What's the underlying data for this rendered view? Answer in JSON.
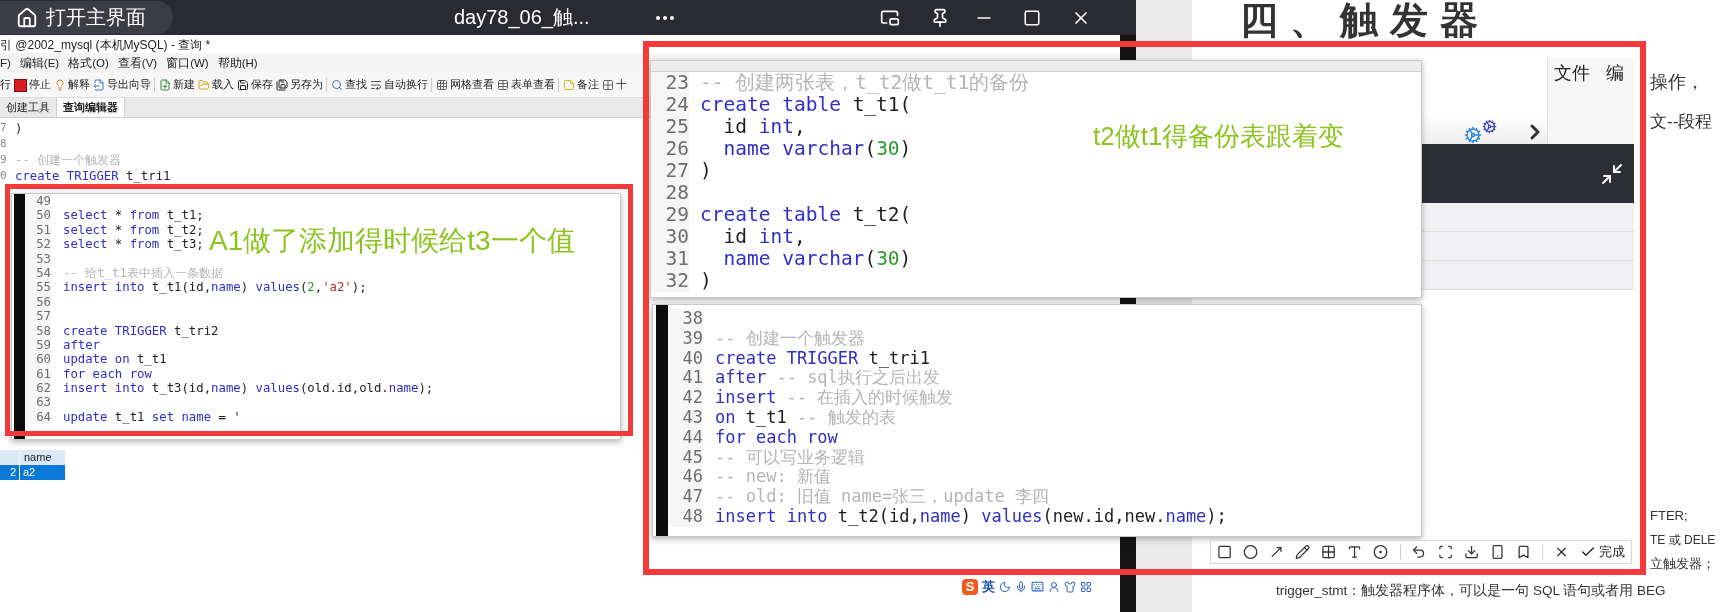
{
  "top_bar": {
    "home_button": "打开主界面",
    "title": "day78_06_触..."
  },
  "editor_window": {
    "title": "引 @2002_mysql (本机MySQL) - 查询 *",
    "menu": [
      "F)",
      "编辑(E)",
      "格式(O)",
      "查看(V)",
      "窗口(W)",
      "帮助(H)"
    ],
    "toolbar": [
      [
        {
          "label": "行",
          "kind": "run"
        },
        {
          "label": "停止",
          "kind": "stop"
        },
        {
          "label": "解释",
          "kind": "explain"
        },
        {
          "label": "导出向导",
          "kind": "export"
        }
      ],
      [
        {
          "label": "新建",
          "kind": "new"
        },
        {
          "label": "载入",
          "kind": "load"
        },
        {
          "label": "保存",
          "kind": "save"
        },
        {
          "label": "另存为",
          "kind": "save_as"
        }
      ],
      [
        {
          "label": "查找",
          "kind": "find"
        },
        {
          "label": "自动换行",
          "kind": "wrap"
        }
      ],
      [
        {
          "label": "网格查看",
          "kind": "grid"
        },
        {
          "label": "表单查看",
          "kind": "form"
        }
      ],
      [
        {
          "label": "备注",
          "kind": "note"
        },
        {
          "label": "十",
          "kind": "hex"
        }
      ]
    ],
    "tabs": [
      {
        "label": "创建工具",
        "selected": false
      },
      {
        "label": "查询编辑器",
        "selected": true
      }
    ],
    "code": [
      {
        "n": "7",
        "tokens": [
          {
            "kind": "plain",
            "text": ")"
          }
        ]
      },
      {
        "n": "8"
      },
      {
        "n": "9",
        "tokens": [
          {
            "kind": "comment",
            "text": "-- 创建一个触发器"
          }
        ]
      },
      {
        "n": "0",
        "tokens": [
          {
            "kind": "keyword",
            "text": "create TRIGGER"
          },
          {
            "kind": "plain",
            "text": " t_tri1"
          }
        ]
      }
    ],
    "result": {
      "columns": [
        "name"
      ],
      "rows": [
        {
          "num": "2",
          "cells": [
            "a2"
          ],
          "selected": true
        }
      ]
    }
  },
  "popups": [
    {
      "kind": "small",
      "annotation": "A1做了添加得时候给t3一个值",
      "lines": [
        {
          "n": "49"
        },
        {
          "n": "50",
          "tokens": [
            {
              "kind": "keyword",
              "text": "select"
            },
            {
              "kind": "plain",
              "text": " * "
            },
            {
              "kind": "keyword",
              "text": "from"
            },
            {
              "kind": "plain",
              "text": " t_t1;"
            }
          ]
        },
        {
          "n": "51",
          "tokens": [
            {
              "kind": "keyword",
              "text": "select"
            },
            {
              "kind": "plain",
              "text": " * "
            },
            {
              "kind": "keyword",
              "text": "from"
            },
            {
              "kind": "plain",
              "text": " t_t2;"
            }
          ]
        },
        {
          "n": "52",
          "tokens": [
            {
              "kind": "keyword",
              "text": "select"
            },
            {
              "kind": "plain",
              "text": " * "
            },
            {
              "kind": "keyword",
              "text": "from"
            },
            {
              "kind": "plain",
              "text": " t_t3;"
            }
          ]
        },
        {
          "n": "53"
        },
        {
          "n": "54",
          "tokens": [
            {
              "kind": "comment",
              "text": "-- 给t_t1表中插入一条数据"
            }
          ]
        },
        {
          "n": "55",
          "tokens": [
            {
              "kind": "keyword",
              "text": "insert into"
            },
            {
              "kind": "plain",
              "text": " t_t1(id,"
            },
            {
              "kind": "keyword",
              "text": "name"
            },
            {
              "kind": "plain",
              "text": ") "
            },
            {
              "kind": "keyword",
              "text": "values"
            },
            {
              "kind": "plain",
              "text": "("
            },
            {
              "kind": "number",
              "text": "2"
            },
            {
              "kind": "plain",
              "text": ","
            },
            {
              "kind": "string",
              "text": "'a2'"
            },
            {
              "kind": "plain",
              "text": ");"
            }
          ]
        },
        {
          "n": "56"
        },
        {
          "n": "57"
        },
        {
          "n": "58",
          "tokens": [
            {
              "kind": "keyword",
              "text": "create TRIGGER"
            },
            {
              "kind": "plain",
              "text": " t_tri2"
            }
          ]
        },
        {
          "n": "59",
          "tokens": [
            {
              "kind": "keyword",
              "text": "after"
            }
          ]
        },
        {
          "n": "60",
          "tokens": [
            {
              "kind": "keyword",
              "text": "update on"
            },
            {
              "kind": "plain",
              "text": " t_t1"
            }
          ]
        },
        {
          "n": "61",
          "tokens": [
            {
              "kind": "keyword",
              "text": "for each row"
            }
          ]
        },
        {
          "n": "62",
          "tokens": [
            {
              "kind": "keyword",
              "text": "insert into"
            },
            {
              "kind": "plain",
              "text": " t_t3(id,"
            },
            {
              "kind": "keyword",
              "text": "name"
            },
            {
              "kind": "plain",
              "text": ") "
            },
            {
              "kind": "keyword",
              "text": "values"
            },
            {
              "kind": "plain",
              "text": "(old.id,old."
            },
            {
              "kind": "keyword",
              "text": "name"
            },
            {
              "kind": "plain",
              "text": ");"
            }
          ]
        },
        {
          "n": "63"
        },
        {
          "n": "64",
          "tokens": [
            {
              "kind": "keyword",
              "text": "update"
            },
            {
              "kind": "plain",
              "text": " t_t1 "
            },
            {
              "kind": "keyword",
              "text": "set name"
            },
            {
              "kind": "plain",
              "text": " = '"
            }
          ]
        }
      ]
    },
    {
      "kind": "large",
      "annotation": "t2做t1得备份表跟着变",
      "lines": [
        {
          "n": "23",
          "tokens": [
            {
              "kind": "comment",
              "text": "-- 创建两张表，t_t2做t_t1的备份"
            }
          ]
        },
        {
          "n": "24",
          "tokens": [
            {
              "kind": "keyword",
              "text": "create table"
            },
            {
              "kind": "plain",
              "text": " t_t1("
            }
          ]
        },
        {
          "n": "25",
          "tokens": [
            {
              "kind": "plain",
              "text": "  id "
            },
            {
              "kind": "keyword",
              "text": "int"
            },
            {
              "kind": "plain",
              "text": ","
            }
          ]
        },
        {
          "n": "26",
          "tokens": [
            {
              "kind": "keyword",
              "text": "  name varchar"
            },
            {
              "kind": "plain",
              "text": "("
            },
            {
              "kind": "number",
              "text": "30"
            },
            {
              "kind": "plain",
              "text": ")"
            }
          ]
        },
        {
          "n": "27",
          "tokens": [
            {
              "kind": "plain",
              "text": ")"
            }
          ]
        },
        {
          "n": "28"
        },
        {
          "n": "29",
          "tokens": [
            {
              "kind": "keyword",
              "text": "create table"
            },
            {
              "kind": "plain",
              "text": " t_t2("
            }
          ]
        },
        {
          "n": "30",
          "tokens": [
            {
              "kind": "plain",
              "text": "  id "
            },
            {
              "kind": "keyword",
              "text": "int"
            },
            {
              "kind": "plain",
              "text": ","
            }
          ]
        },
        {
          "n": "31",
          "tokens": [
            {
              "kind": "keyword",
              "text": "  name varchar"
            },
            {
              "kind": "plain",
              "text": "("
            },
            {
              "kind": "number",
              "text": "30"
            },
            {
              "kind": "plain",
              "text": ")"
            }
          ]
        },
        {
          "n": "32",
          "tokens": [
            {
              "kind": "plain",
              "text": ")"
            }
          ]
        }
      ]
    },
    {
      "kind": "medium",
      "lines": [
        {
          "n": "38"
        },
        {
          "n": "39",
          "tokens": [
            {
              "kind": "comment",
              "text": "-- 创建一个触发器"
            }
          ]
        },
        {
          "n": "40",
          "tokens": [
            {
              "kind": "keyword",
              "text": "create TRIGGER"
            },
            {
              "kind": "plain",
              "text": " t_tri1"
            }
          ]
        },
        {
          "n": "41",
          "tokens": [
            {
              "kind": "keyword",
              "text": "after"
            },
            {
              "kind": "comment",
              "text": " -- sql执行之后出发"
            }
          ]
        },
        {
          "n": "42",
          "tokens": [
            {
              "kind": "keyword",
              "text": "insert"
            },
            {
              "kind": "comment",
              "text": " -- 在插入的时候触发"
            }
          ]
        },
        {
          "n": "43",
          "tokens": [
            {
              "kind": "keyword",
              "text": "on"
            },
            {
              "kind": "plain",
              "text": " t_t1"
            },
            {
              "kind": "comment",
              "text": " -- 触发的表"
            }
          ]
        },
        {
          "n": "44",
          "tokens": [
            {
              "kind": "keyword",
              "text": "for each row"
            }
          ]
        },
        {
          "n": "45",
          "tokens": [
            {
              "kind": "comment",
              "text": "-- 可以写业务逻辑"
            }
          ]
        },
        {
          "n": "46",
          "tokens": [
            {
              "kind": "comment",
              "text": "-- new: 新值"
            }
          ]
        },
        {
          "n": "47",
          "tokens": [
            {
              "kind": "comment",
              "text": "-- old: 旧值 name=张三，update 李四"
            }
          ]
        },
        {
          "n": "48",
          "tokens": [
            {
              "kind": "keyword",
              "text": "insert into"
            },
            {
              "kind": "plain",
              "text": " t_t2(id,"
            },
            {
              "kind": "keyword",
              "text": "name"
            },
            {
              "kind": "plain",
              "text": ") "
            },
            {
              "kind": "keyword",
              "text": "values"
            },
            {
              "kind": "plain",
              "text": "(new.id,new."
            },
            {
              "kind": "keyword",
              "text": "name"
            },
            {
              "kind": "plain",
              "text": ");"
            }
          ]
        }
      ]
    }
  ],
  "background_window": {
    "menu": [
      "文件",
      "编"
    ]
  },
  "document": {
    "heading": "四、触发器",
    "lines": [
      "操作，",
      "文--段程",
      "FTER;",
      "TE 或 DELE",
      "立触发器；",
      "trigger_stmt：触发器程序体，可以是一句 SQL 语句或者用 BEG"
    ]
  },
  "snip_toolbar": {
    "done": "完成"
  },
  "ime": {
    "logo": "S",
    "mode": "英"
  }
}
